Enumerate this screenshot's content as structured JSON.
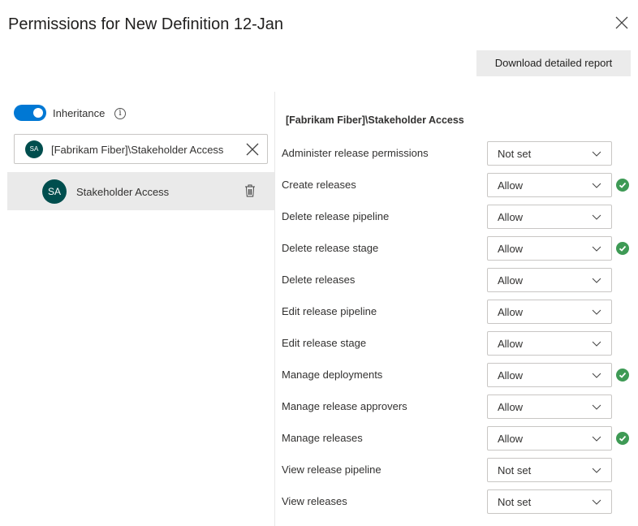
{
  "dialog": {
    "title": "Permissions for New Definition 12-Jan",
    "download_label": "Download detailed report"
  },
  "left": {
    "inheritance_label": "Inheritance",
    "inheritance_on": true,
    "search_value": "[Fabrikam Fiber]\\Stakeholder Access",
    "search_avatar": "SA",
    "selected": {
      "avatar": "SA",
      "name": "Stakeholder Access"
    }
  },
  "right": {
    "group_title": "[Fabrikam Fiber]\\Stakeholder Access",
    "permissions": [
      {
        "label": "Administer release permissions",
        "value": "Not set",
        "check": false
      },
      {
        "label": "Create releases",
        "value": "Allow",
        "check": true
      },
      {
        "label": "Delete release pipeline",
        "value": "Allow",
        "check": false
      },
      {
        "label": "Delete release stage",
        "value": "Allow",
        "check": true
      },
      {
        "label": "Delete releases",
        "value": "Allow",
        "check": false
      },
      {
        "label": "Edit release pipeline",
        "value": "Allow",
        "check": false
      },
      {
        "label": "Edit release stage",
        "value": "Allow",
        "check": false
      },
      {
        "label": "Manage deployments",
        "value": "Allow",
        "check": true
      },
      {
        "label": "Manage release approvers",
        "value": "Allow",
        "check": false
      },
      {
        "label": "Manage releases",
        "value": "Allow",
        "check": true
      },
      {
        "label": "View release pipeline",
        "value": "Not set",
        "check": false
      },
      {
        "label": "View releases",
        "value": "Not set",
        "check": false
      }
    ]
  },
  "colors": {
    "accent": "#0078d4",
    "avatar": "#004e4e",
    "check": "#3e9a55"
  }
}
